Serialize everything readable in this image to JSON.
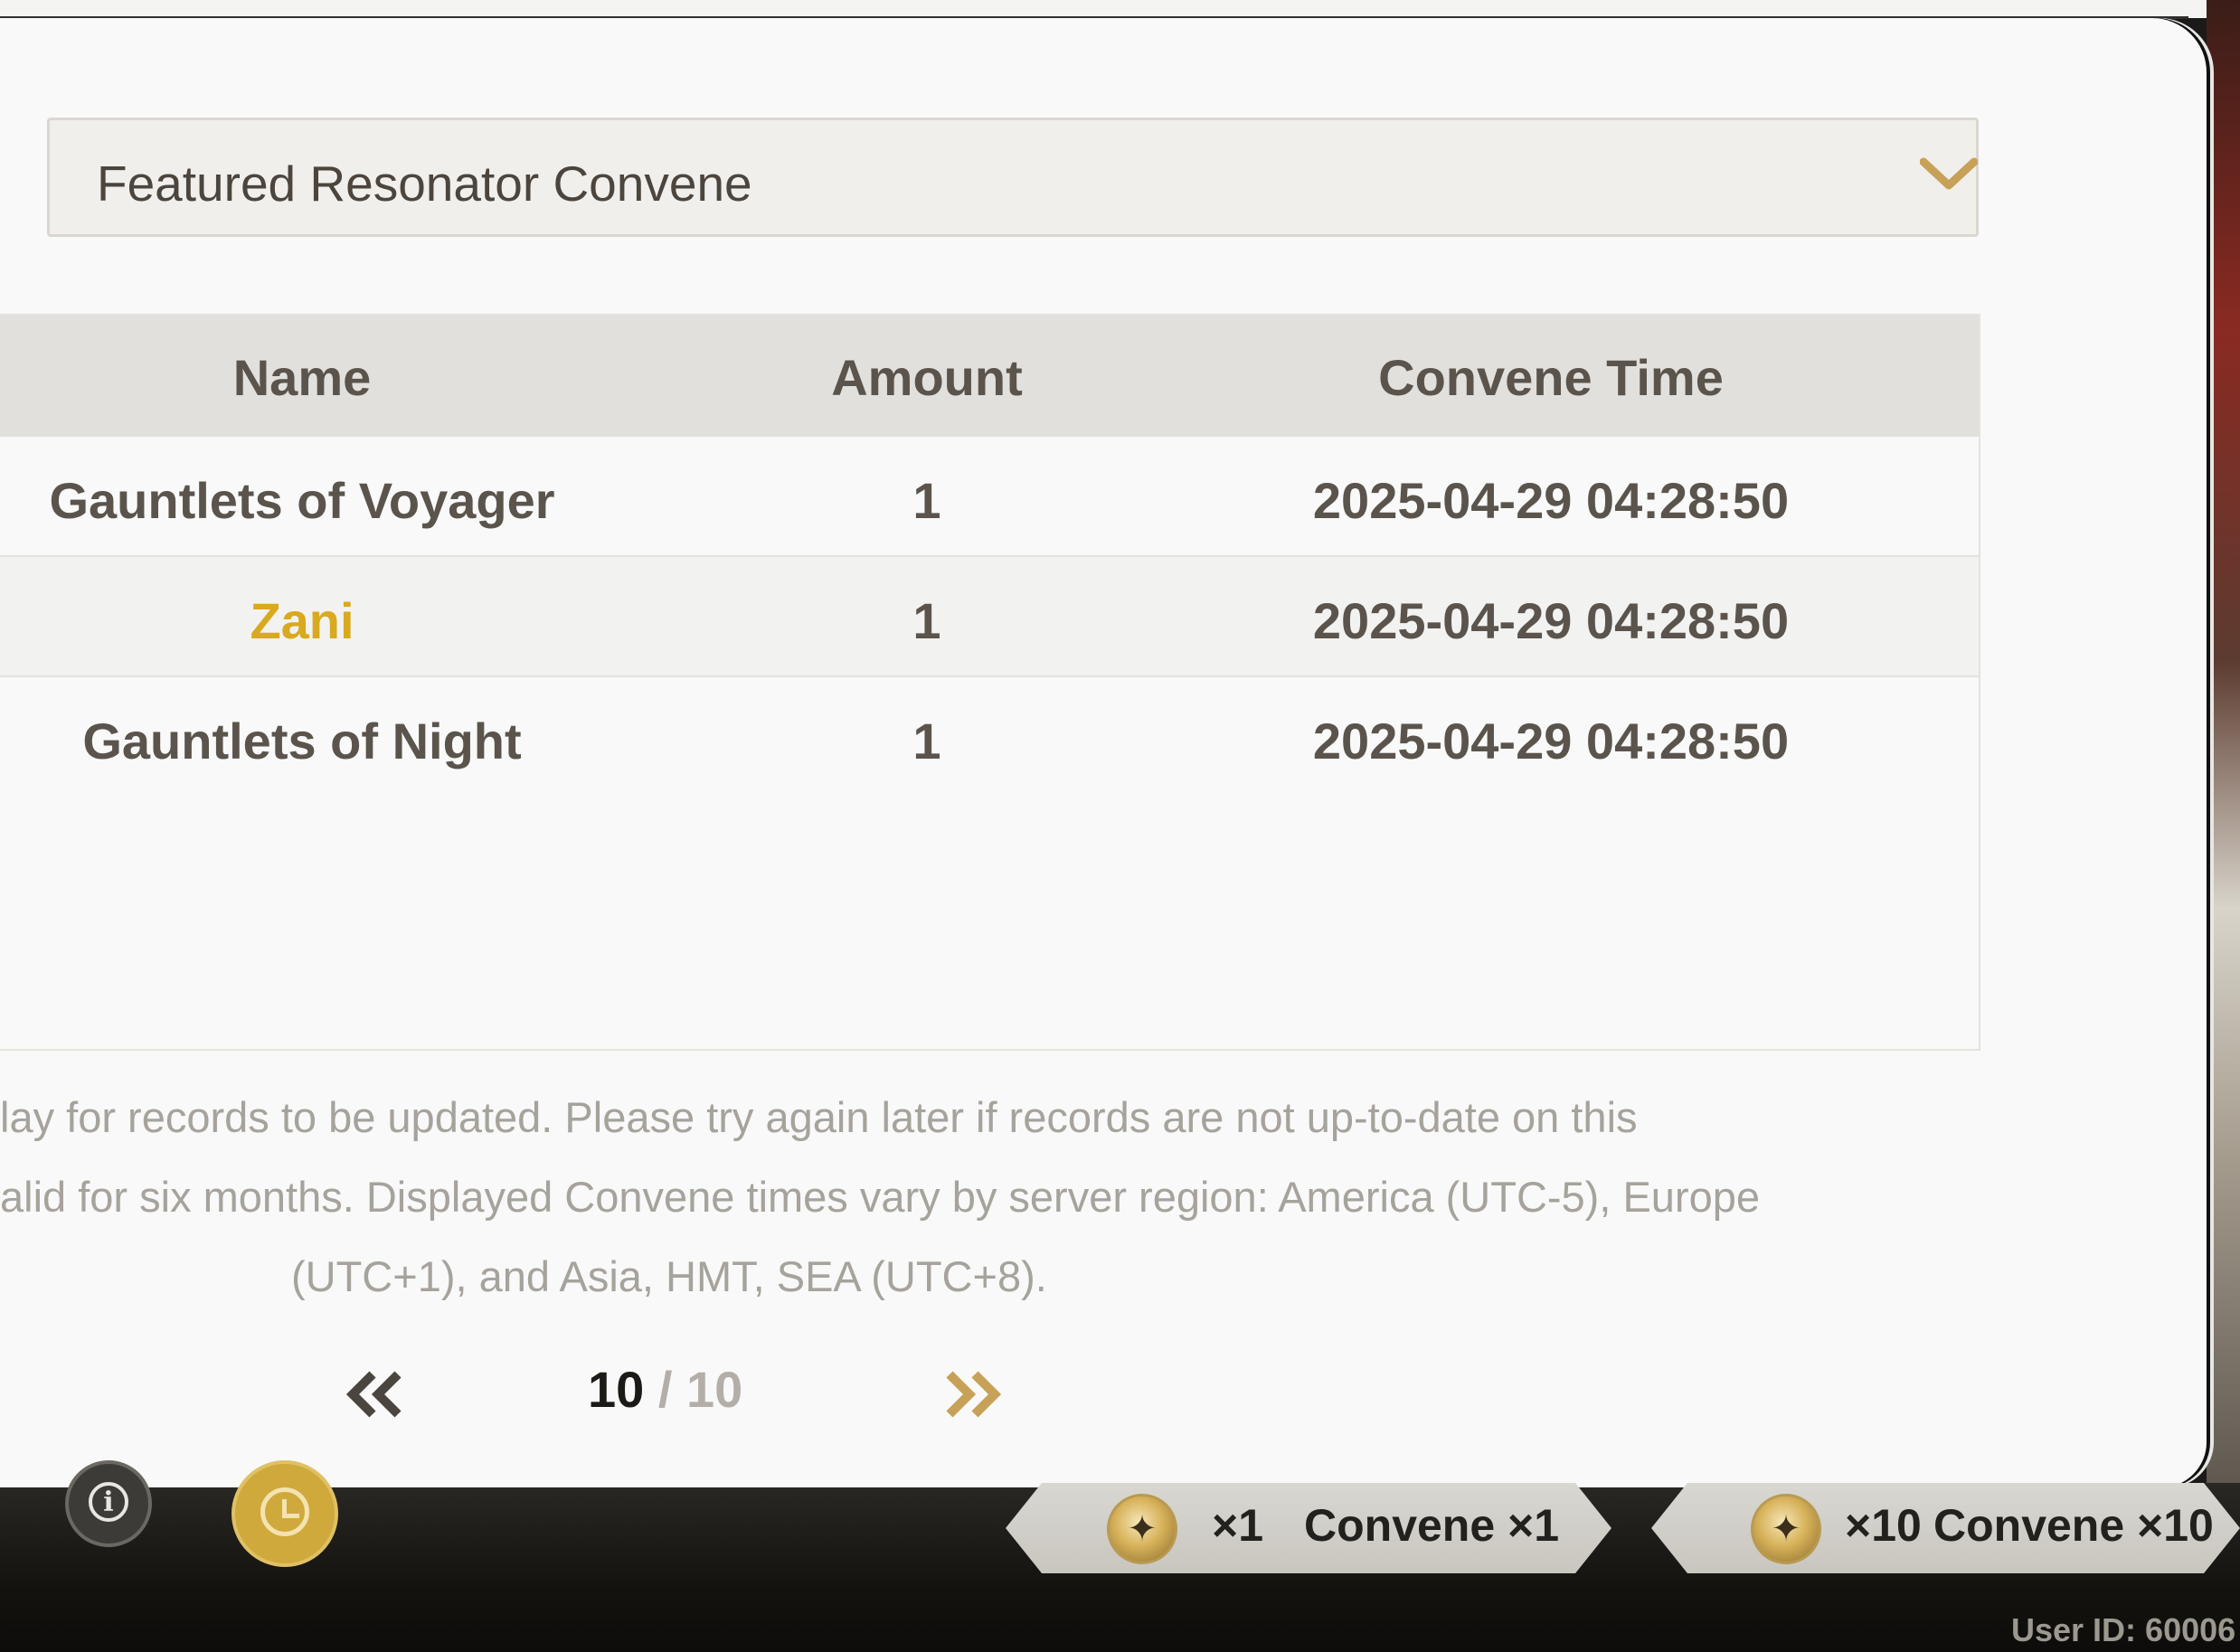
{
  "dropdown": {
    "selected": "Featured Resonator Convene"
  },
  "table": {
    "headers": [
      "Name",
      "Amount",
      "Convene Time"
    ],
    "rows": [
      {
        "name": "Gauntlets of Voyager",
        "amount": "1",
        "time": "2025-04-29 04:28:50",
        "rarity_color": "#5a544c"
      },
      {
        "name": "Zani",
        "amount": "1",
        "time": "2025-04-29 04:28:50",
        "rarity_color": "#d9a91e"
      },
      {
        "name": "Gauntlets of Night",
        "amount": "1",
        "time": "2025-04-29 04:28:50",
        "rarity_color": "#5a544c"
      }
    ]
  },
  "notice": {
    "line1": "lay for records to be updated. Please try again later if records are not up-to-date on this",
    "line2": "alid for six months. Displayed Convene times vary by server region: America (UTC-5), Europe",
    "line3": "(UTC+1), and Asia, HMT, SEA (UTC+8)."
  },
  "pagination": {
    "current": "10",
    "separator": "/",
    "total": "10",
    "prev_icon": "double-chevron-left-icon",
    "next_icon": "double-chevron-right-icon"
  },
  "hud": {
    "info_icon": "info-icon",
    "history_icon": "history-clock-icon",
    "convene1": {
      "count": "×1",
      "label": "Convene ×1"
    },
    "convene10": {
      "count": "×10",
      "label": "Convene ×10"
    },
    "user_id": "User ID: 60006"
  },
  "colors": {
    "accent_gold": "#c7a158",
    "five_star": "#d9a91e",
    "text": "#5a544c"
  }
}
